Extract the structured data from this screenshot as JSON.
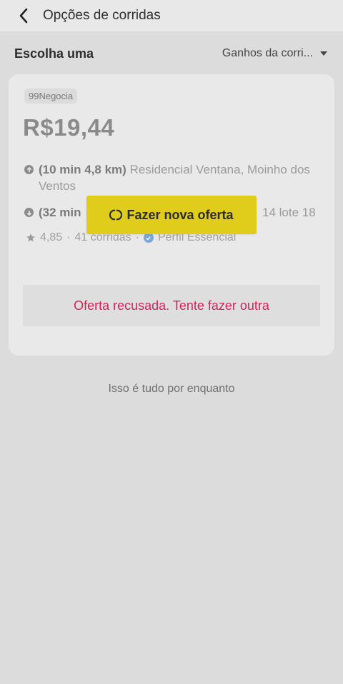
{
  "header": {
    "title": "Opções de corridas"
  },
  "filters": {
    "choose_label": "Escolha uma",
    "sort_label": "Ganhos da corri..."
  },
  "ride": {
    "badge": "99Negocia",
    "price": "R$19,44",
    "pickup": {
      "eta": "(10 min 4,8 km)",
      "address": "Residencial Ventana, Moinho dos Ventos"
    },
    "dropoff": {
      "eta_partial": "(32 min",
      "address_partial": "14 lote 18"
    },
    "rating": "4,85",
    "trips": "41 corridas",
    "profile": "Perfil Essencial",
    "status": "Oferta recusada. Tente fazer outra"
  },
  "actions": {
    "new_offer": "Fazer nova oferta"
  },
  "footer": {
    "end_text": "Isso é tudo por enquanto"
  },
  "colors": {
    "offer_button": "#e0cc1a",
    "refused_text": "#c8285a"
  },
  "icons": [
    "back-arrow-icon",
    "caret-down-icon",
    "pickup-arrow-up-icon",
    "dropoff-arrow-down-icon",
    "star-icon",
    "verified-icon",
    "loading-spinner-icon"
  ]
}
